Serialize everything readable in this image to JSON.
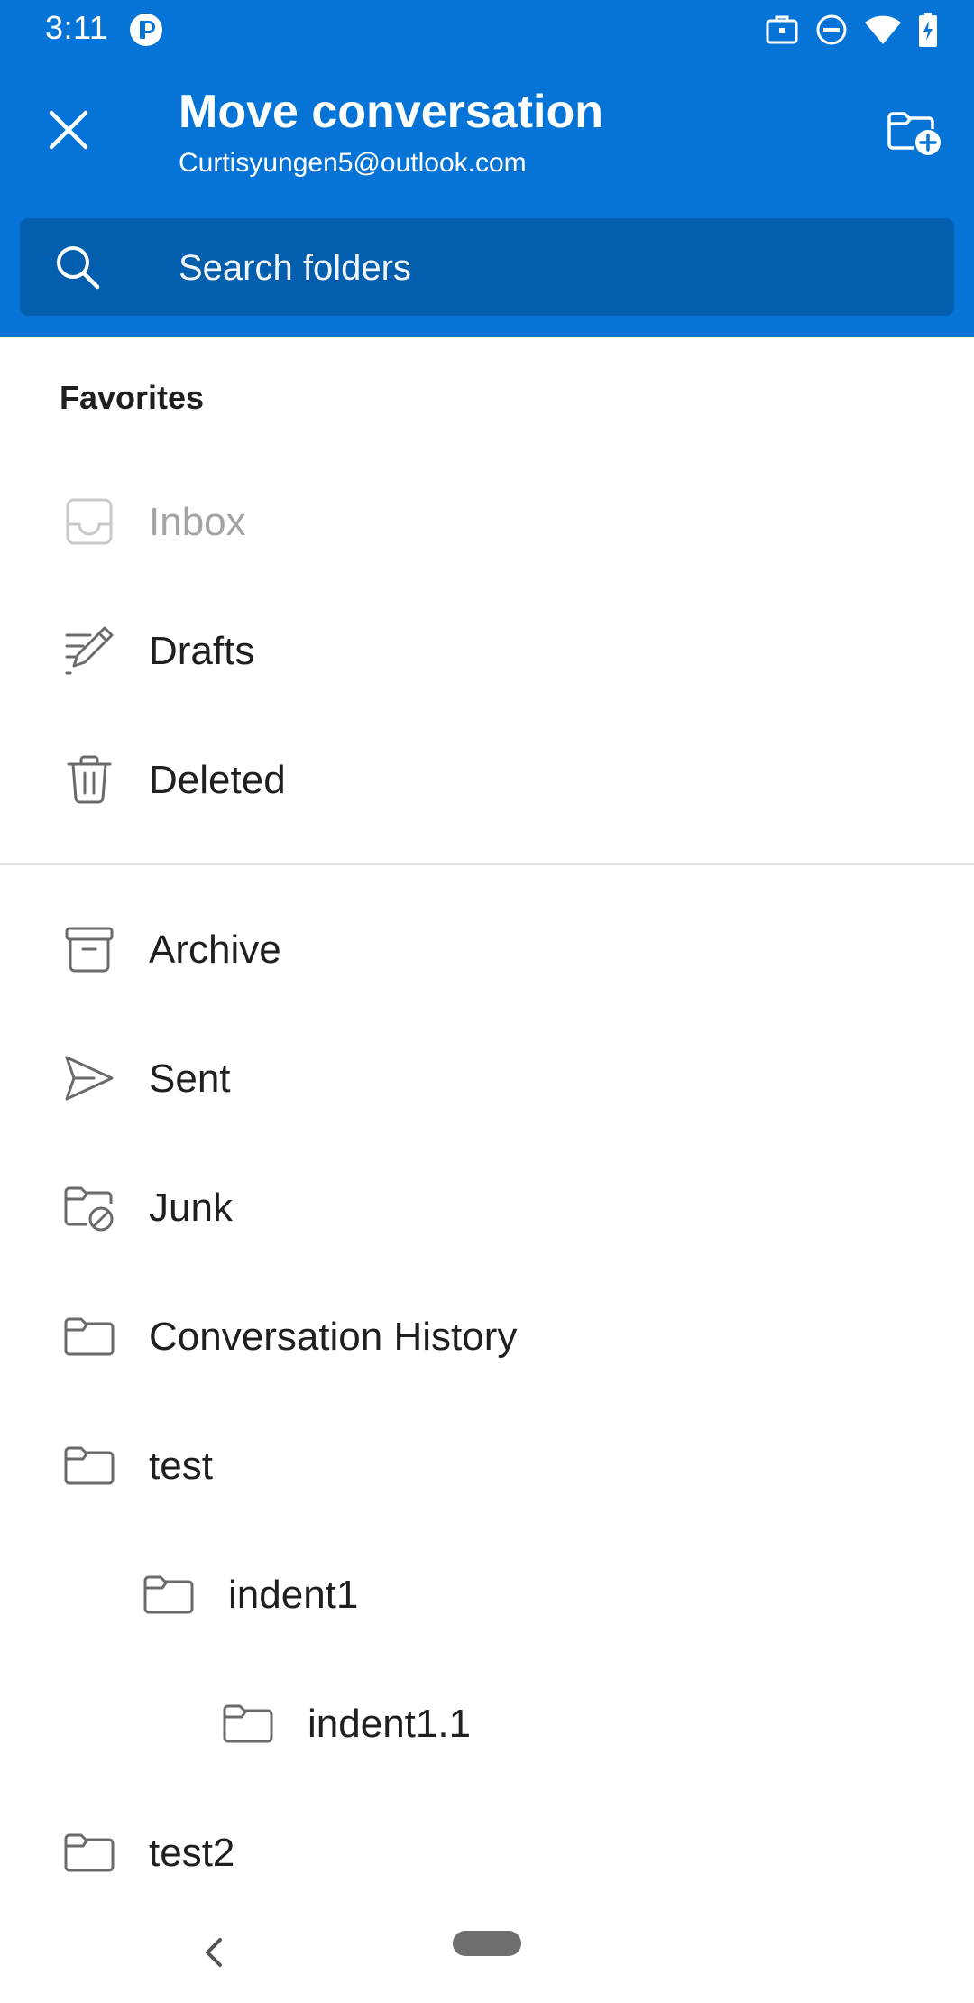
{
  "status_bar": {
    "time": "3:11"
  },
  "header": {
    "title": "Move conversation",
    "account": "Curtisyungen5@outlook.com",
    "background_color": "#0574d6",
    "search_background_color": "#045eae"
  },
  "search": {
    "placeholder": "Search folders"
  },
  "favorites": {
    "label": "Favorites",
    "items": [
      {
        "label": "Inbox",
        "icon": "inbox-icon",
        "disabled": true
      },
      {
        "label": "Drafts",
        "icon": "drafts-pencil-icon",
        "disabled": false
      },
      {
        "label": "Deleted",
        "icon": "trash-icon",
        "disabled": false
      }
    ]
  },
  "folders": {
    "items": [
      {
        "label": "Archive",
        "icon": "archive-icon",
        "level": 0
      },
      {
        "label": "Sent",
        "icon": "send-icon",
        "level": 0
      },
      {
        "label": "Junk",
        "icon": "junk-folder-icon",
        "level": 0
      },
      {
        "label": "Conversation History",
        "icon": "folder-icon",
        "level": 0
      },
      {
        "label": "test",
        "icon": "folder-icon",
        "level": 0
      },
      {
        "label": "indent1",
        "icon": "folder-icon",
        "level": 1
      },
      {
        "label": "indent1.1",
        "icon": "folder-icon",
        "level": 2
      },
      {
        "label": "test2",
        "icon": "folder-icon",
        "level": 0
      }
    ]
  }
}
